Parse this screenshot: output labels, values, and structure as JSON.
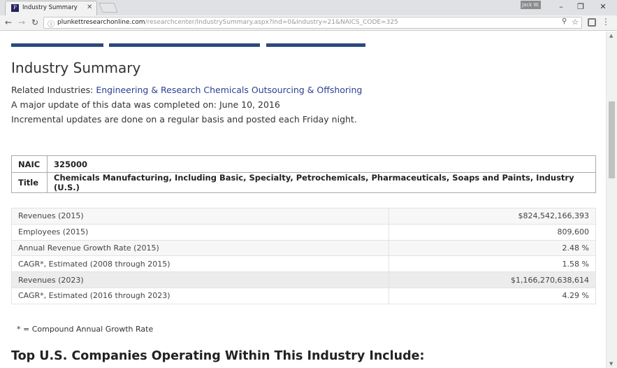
{
  "browser": {
    "tab_title": "Industry Summary",
    "favicon_glyph": "P",
    "user_label": "Jack W.",
    "url_host": "plunkettresearchonline.com",
    "url_path": "/researchcenter/IndustrySummary.aspx?Ind=0&Industry=21&NAICS_CODE=325"
  },
  "page": {
    "title": "Industry Summary",
    "related_label": "Related Industries:",
    "related_industries": [
      "Engineering & Research",
      "Chemicals",
      "Outsourcing & Offshoring"
    ],
    "update_line": "A major update of this data was completed on: June 10, 2016",
    "incremental_line": "Incremental updates are done on a regular basis and posted each Friday night.",
    "naics_table": [
      {
        "key": "NAIC",
        "value": "325000"
      },
      {
        "key": "Title",
        "value": "Chemicals Manufacturing, Including Basic, Specialty, Petrochemicals, Pharmaceuticals, Soaps and Paints, Industry (U.S.)"
      }
    ],
    "stats": [
      {
        "label": "Revenues (2015)",
        "value": "$824,542,166,393"
      },
      {
        "label": "Employees (2015)",
        "value": "809,600"
      },
      {
        "label": "Annual Revenue Growth Rate (2015)",
        "value": "2.48 %"
      },
      {
        "label": "CAGR*, Estimated (2008 through 2015)",
        "value": "1.58 %"
      },
      {
        "label": "Revenues (2023)",
        "value": "$1,166,270,638,614"
      },
      {
        "label": "CAGR*, Estimated (2016 through 2023)",
        "value": "4.29 %"
      }
    ],
    "footnote": "* = Compound Annual Growth Rate",
    "companies_heading": "Top U.S. Companies Operating Within This Industry Include:"
  }
}
